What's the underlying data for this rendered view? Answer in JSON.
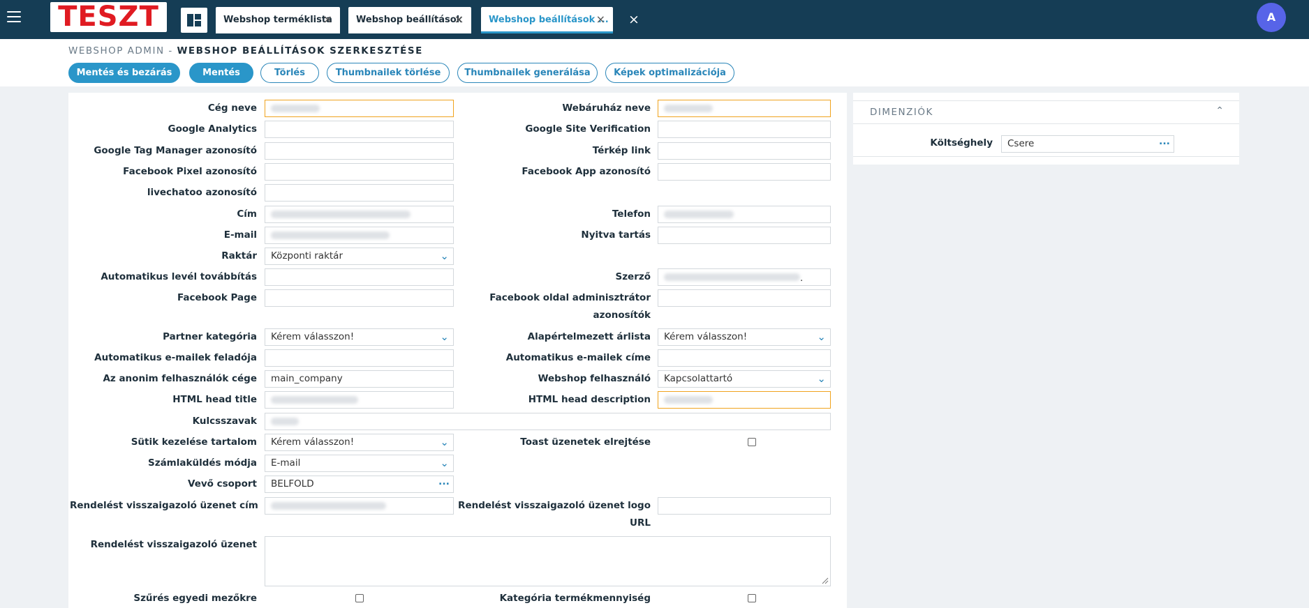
{
  "topbar": {
    "logo_text": "TESZT",
    "tabs": [
      {
        "label": "Webshop terméklista"
      },
      {
        "label": "Webshop beállítások"
      },
      {
        "label": "Webshop beállítások ..."
      }
    ],
    "close_symbol": "×",
    "avatar_initial": "A",
    "icons": [
      "hamburger-menu-icon",
      "dashboard-icon",
      "close-icon"
    ]
  },
  "header": {
    "breadcrumb_parent": "WEBSHOP ADMIN -",
    "breadcrumb_current": "WEBSHOP BEÁLLÍTÁSOK SZERKESZTÉSE",
    "buttons": {
      "save_close": "Mentés és bezárás",
      "save": "Mentés",
      "delete": "Törlés",
      "thumb_delete": "Thumbnailek törlése",
      "thumb_generate": "Thumbnailek generálása",
      "image_optimize": "Képek optimalizációja"
    }
  },
  "form": {
    "company_name": {
      "label": "Cég neve"
    },
    "shop_name": {
      "label": "Webáruház neve"
    },
    "google_analytics": {
      "label": "Google Analytics",
      "value": ""
    },
    "google_site_verification": {
      "label": "Google Site Verification",
      "value": ""
    },
    "gtm_id": {
      "label": "Google Tag Manager azonosító",
      "value": ""
    },
    "map_link": {
      "label": "Térkép link",
      "value": ""
    },
    "fb_pixel": {
      "label": "Facebook Pixel azonosító",
      "value": ""
    },
    "fb_app": {
      "label": "Facebook App azonosító",
      "value": ""
    },
    "livechatoo": {
      "label": "livechatoo azonosító",
      "value": ""
    },
    "address": {
      "label": "Cím"
    },
    "phone": {
      "label": "Telefon"
    },
    "email": {
      "label": "E-mail"
    },
    "opening_hours": {
      "label": "Nyitva tartás",
      "value": ""
    },
    "warehouse": {
      "label": "Raktár",
      "value": "Központi raktár"
    },
    "auto_forward": {
      "label": "Automatikus levél továbbítás",
      "value": ""
    },
    "author": {
      "label": "Szerző",
      "value_suffix": "."
    },
    "fb_page": {
      "label": "Facebook Page",
      "value": ""
    },
    "fb_admins": {
      "label_line1": "Facebook oldal adminisztrátor",
      "label_line2": "azonosítók",
      "value": ""
    },
    "partner_category": {
      "label": "Partner kategória",
      "value": "Kérem válasszon!"
    },
    "default_pricelist": {
      "label": "Alapértelmezett árlista",
      "value": "Kérem válasszon!"
    },
    "auto_email_sender": {
      "label": "Automatikus e-mailek feladója",
      "value": ""
    },
    "auto_email_address": {
      "label": "Automatikus e-mailek címe",
      "value": ""
    },
    "anon_company": {
      "label": "Az anonim felhasználók cége",
      "value": "main_company"
    },
    "webshop_user": {
      "label": "Webshop felhasználó",
      "value": "Kapcsolattartó"
    },
    "html_title": {
      "label": "HTML head title"
    },
    "html_description": {
      "label": "HTML head description"
    },
    "keywords": {
      "label": "Kulcsszavak"
    },
    "cookie_content": {
      "label": "Sütik kezelése tartalom",
      "value": "Kérem válasszon!"
    },
    "hide_toast": {
      "label": "Toast üzenetek elrejtése",
      "checked": false
    },
    "invoice_method": {
      "label": "Számlaküldés módja",
      "value": "E-mail"
    },
    "customer_group": {
      "label": "Vevő csoport",
      "value": "BELFOLD"
    },
    "order_confirm_title": {
      "label": "Rendelést visszaigazoló üzenet cím"
    },
    "order_confirm_logo": {
      "label_line1": "Rendelést visszaigazoló üzenet logo",
      "label_line2": "URL",
      "value": ""
    },
    "order_confirm_message": {
      "label": "Rendelést visszaigazoló üzenet",
      "value": ""
    },
    "custom_field_filter": {
      "label": "Szűrés egyedi mezőkre",
      "checked": false
    },
    "category_quantity": {
      "label": "Kategória termékmennyiség",
      "checked": false
    }
  },
  "dimensions": {
    "title": "DIMENZIÓK",
    "cost_center": {
      "label": "Költséghely",
      "value": "Csere"
    }
  },
  "colors": {
    "topbar": "#153d55",
    "accent": "#2a96c9",
    "highlight_border": "#f0a31e",
    "avatar": "#5764e8",
    "logo_red": "#e01b22"
  }
}
